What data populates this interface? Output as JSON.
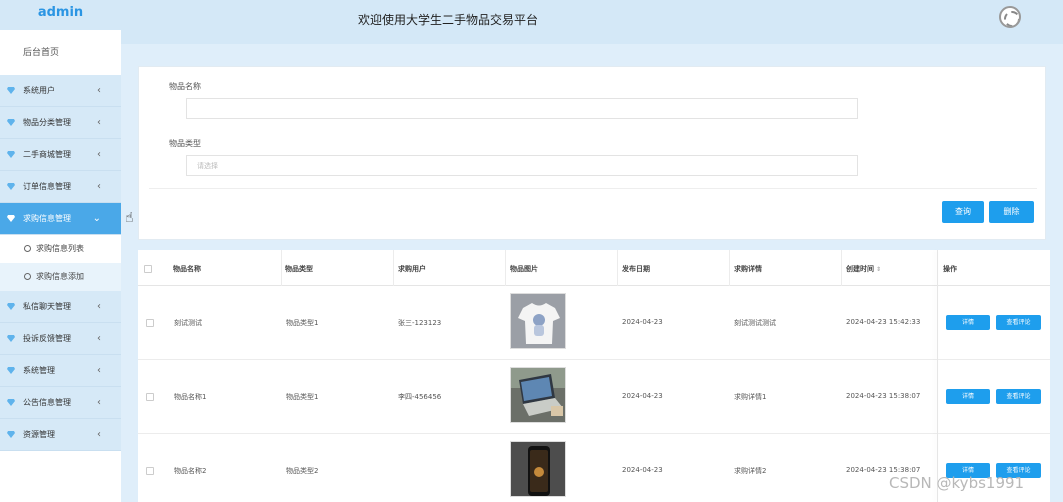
{
  "header": {
    "brand": "admin",
    "title": "欢迎使用大学生二手物品交易平台"
  },
  "sidebar": {
    "home": "后台首页",
    "menu": [
      {
        "label": "系统用户",
        "arrow": "‹"
      },
      {
        "label": "物品分类管理",
        "arrow": "‹"
      },
      {
        "label": "二手商城管理",
        "arrow": "‹"
      },
      {
        "label": "订单信息管理",
        "arrow": "‹"
      },
      {
        "label": "求购信息管理",
        "arrow": "⌄"
      },
      {
        "label": "私信聊天管理",
        "arrow": "‹"
      },
      {
        "label": "投诉反馈管理",
        "arrow": "‹"
      },
      {
        "label": "系统管理",
        "arrow": "‹"
      },
      {
        "label": "公告信息管理",
        "arrow": "‹"
      },
      {
        "label": "资源管理",
        "arrow": "‹"
      }
    ],
    "submenu": [
      "求购信息列表",
      "求购信息添加"
    ]
  },
  "search": {
    "name_label": "物品名称",
    "name_value": "",
    "type_label": "物品类型",
    "type_placeholder": "请选择",
    "query_btn": "查询",
    "delete_btn": "删除"
  },
  "table": {
    "headers": [
      "物品名称",
      "物品类型",
      "求购用户",
      "物品图片",
      "发布日期",
      "求购详情",
      "创建时间",
      "操作"
    ],
    "rows": [
      {
        "name": "刻试测试",
        "type": "物品类型1",
        "user": "张三-123123",
        "date": "2024-04-23",
        "detail": "刻试测试测试",
        "created": "2024-04-23 15:42:33",
        "btn_detail": "详情",
        "btn_review": "查看评论"
      },
      {
        "name": "物品名称1",
        "type": "物品类型1",
        "user": "李四-456456",
        "date": "2024-04-23",
        "detail": "求购详情1",
        "created": "2024-04-23 15:38:07",
        "btn_detail": "详情",
        "btn_review": "查看评论"
      },
      {
        "name": "物品名称2",
        "type": "物品类型2",
        "user": "",
        "date": "2024-04-23",
        "detail": "求购详情2",
        "created": "2024-04-23 15:38:07",
        "btn_detail": "详情",
        "btn_review": "查看评论"
      }
    ]
  },
  "watermark": "CSDN @kybs1991",
  "colors": {
    "accent": "#1e9eed",
    "sidebar_active": "#4aa8e8",
    "background": "#dfeefa"
  }
}
